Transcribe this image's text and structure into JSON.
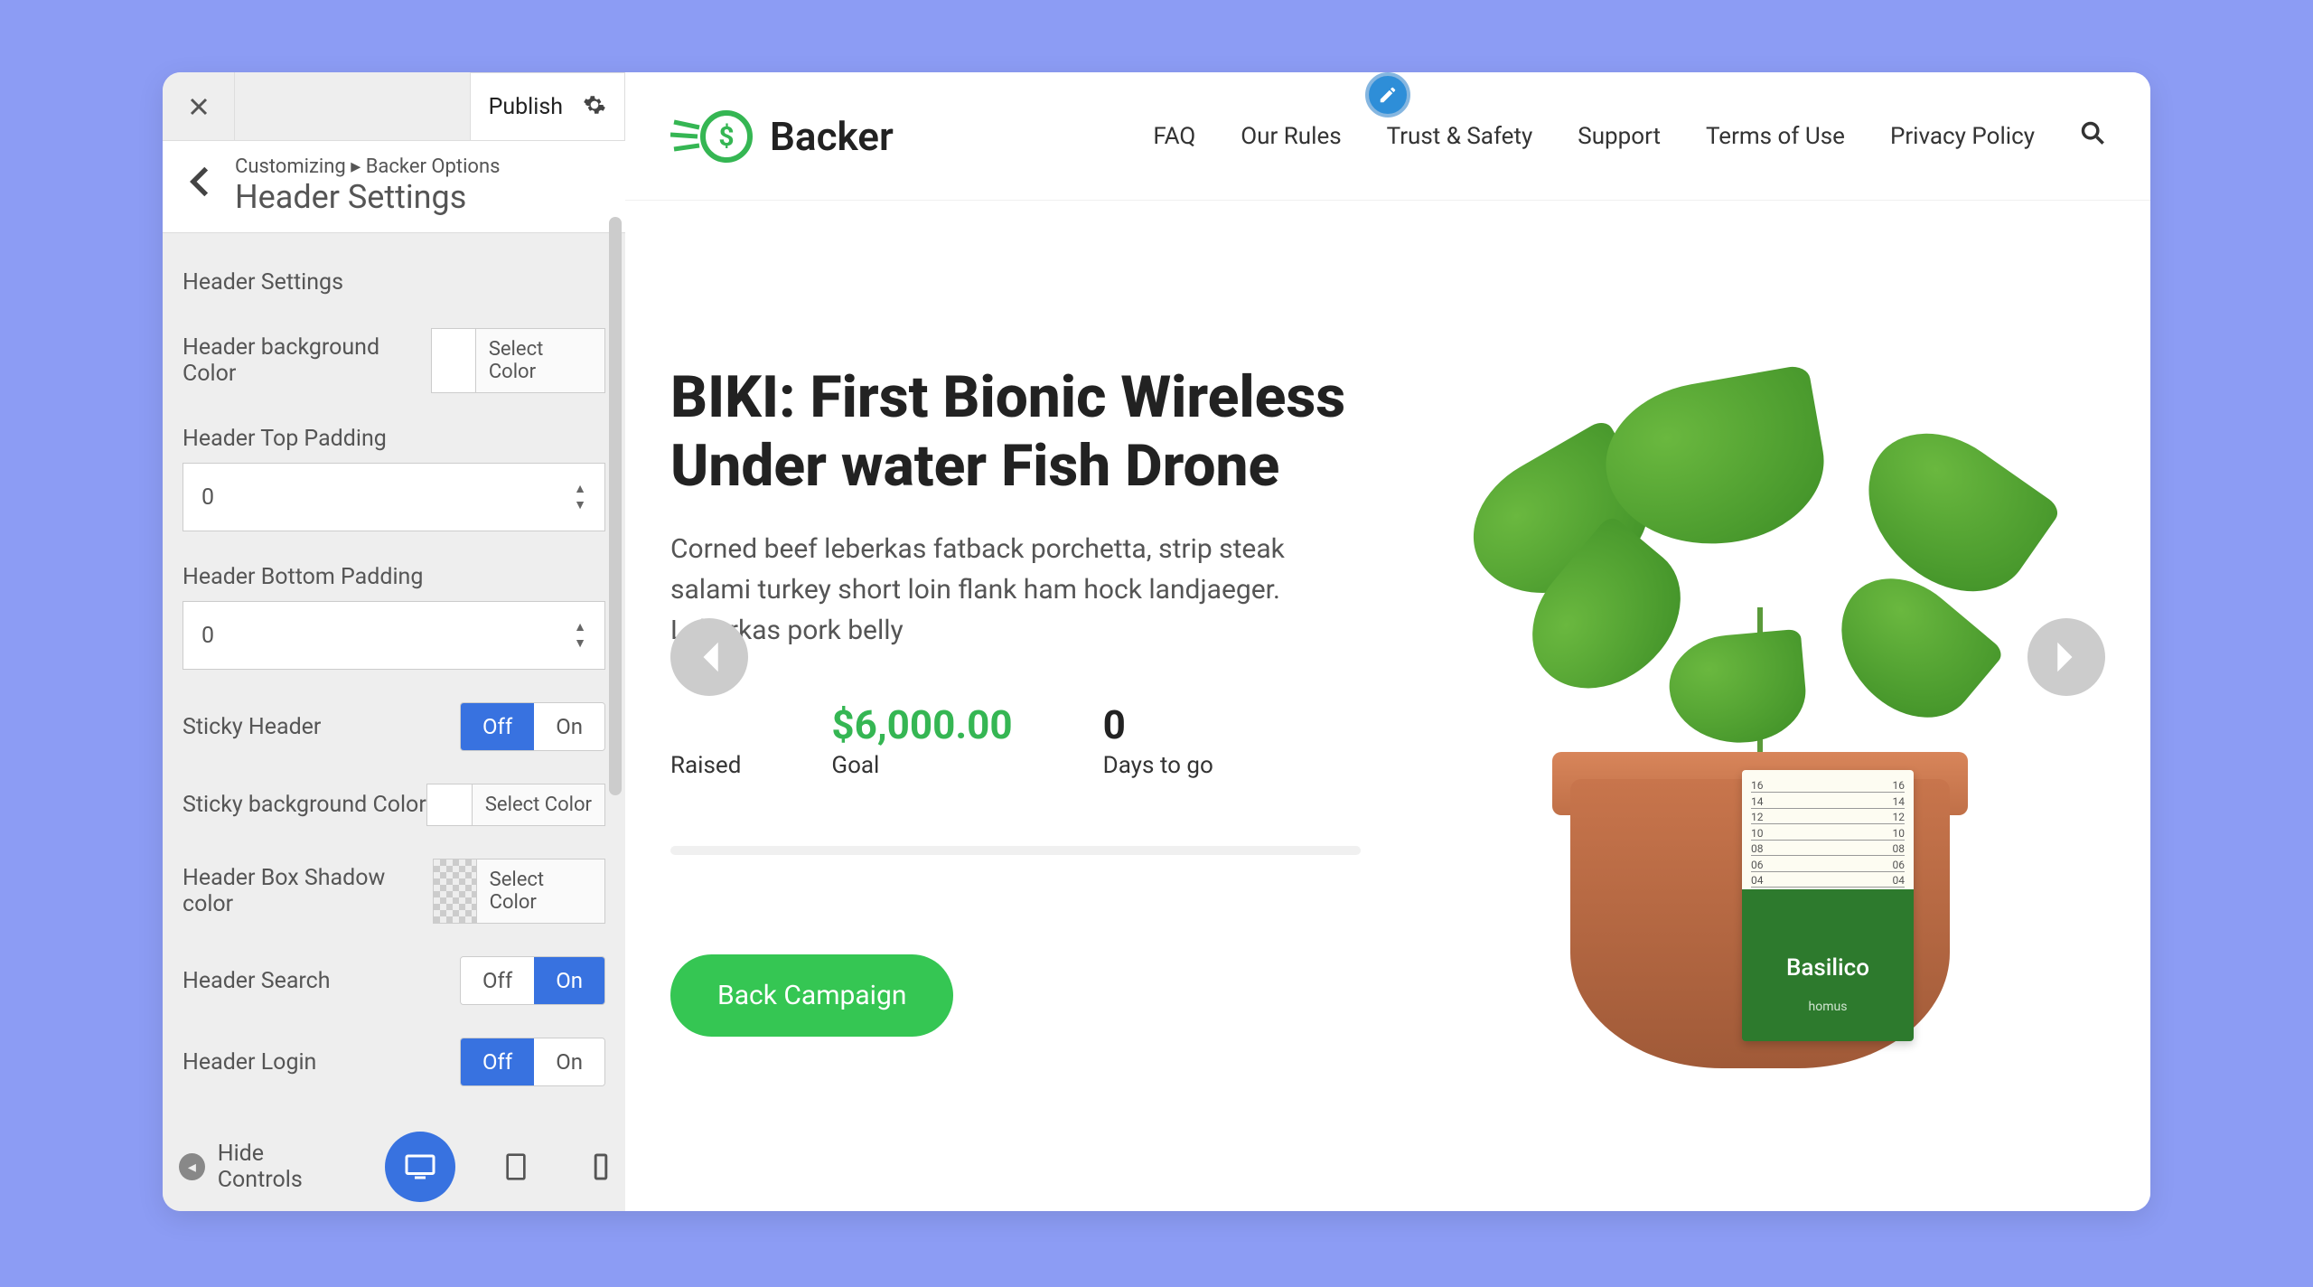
{
  "sidebar": {
    "publish": "Publish",
    "breadcrumb": "Customizing ▸ Backer Options",
    "panel_title": "Header Settings",
    "section_title": "Header Settings",
    "fields": {
      "bg_color_label": "Header background Color",
      "select_color": "Select Color",
      "top_padding_label": "Header Top Padding",
      "top_padding_value": "0",
      "bottom_padding_label": "Header Bottom Padding",
      "bottom_padding_value": "0",
      "sticky_header": "Sticky Header",
      "sticky_bg_label": "Sticky background Color",
      "box_shadow_label": "Header Box Shadow color",
      "header_search": "Header Search",
      "header_login": "Header Login"
    },
    "toggle": {
      "off": "Off",
      "on": "On"
    },
    "footer": {
      "hide": "Hide Controls"
    }
  },
  "preview": {
    "brand": "Backer",
    "nav": {
      "faq": "FAQ",
      "rules": "Our Rules",
      "trust": "Trust & Safety",
      "support": "Support",
      "terms": "Terms of Use",
      "privacy": "Privacy Policy"
    },
    "hero": {
      "title": "BIKI: First Bionic Wireless Under water Fish Drone",
      "desc": "Corned beef leberkas fatback porchetta, strip steak salami turkey short loin flank ham hock landjaeger. Leberkas pork belly",
      "stats": {
        "raised_label": "Raised",
        "goal_value": "$6,000.00",
        "goal_label": "Goal",
        "days_value": "0",
        "days_label": "Days to go"
      },
      "cta": "Back Campaign"
    },
    "plant": {
      "label": "Basilico",
      "sub": "homus",
      "ruler": [
        "16",
        "14",
        "12",
        "10",
        "08",
        "06",
        "04"
      ]
    }
  }
}
